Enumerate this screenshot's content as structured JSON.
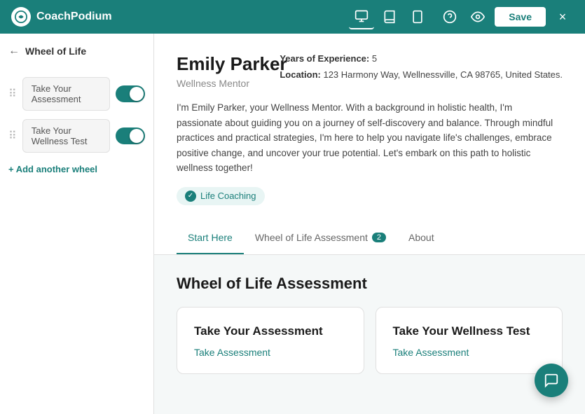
{
  "logo": {
    "name": "CoachPodium",
    "icon": "C"
  },
  "nav": {
    "icons": [
      {
        "id": "desktop",
        "label": "Desktop view",
        "unicode": "🖥",
        "active": true
      },
      {
        "id": "book",
        "label": "Book view",
        "unicode": "📖",
        "active": false
      },
      {
        "id": "mobile",
        "label": "Mobile view",
        "unicode": "📱",
        "active": false
      }
    ],
    "help_icon": "?",
    "eye_icon": "👁",
    "save_label": "Save",
    "close_label": "×"
  },
  "sidebar": {
    "title": "Wheel of Life",
    "back_label": "←",
    "items": [
      {
        "id": "item1",
        "label": "Take Your Assessment",
        "toggle_on": true
      },
      {
        "id": "item2",
        "label": "Take Your Wellness Test",
        "toggle_on": true
      }
    ],
    "add_wheel_label": "+ Add another wheel"
  },
  "profile": {
    "name": "Emily Parker",
    "role": "Wellness Mentor",
    "bio": "I'm Emily Parker, your Wellness Mentor. With a background in holistic health, I'm passionate about guiding you on a journey of self-discovery and balance. Through mindful practices and practical strategies, I'm here to help you navigate life's challenges, embrace positive change, and uncover your true potential. Let's embark on this path to holistic wellness together!",
    "tag": "Life Coaching",
    "meta": {
      "years_label": "Years of Experience:",
      "years_value": "5",
      "location_label": "Location:",
      "location_value": "123 Harmony Way, Wellnessville, CA 98765, United States."
    }
  },
  "tabs": [
    {
      "id": "start-here",
      "label": "Start Here",
      "active": true,
      "badge": null
    },
    {
      "id": "wheel-assessment",
      "label": "Wheel of Life Assessment",
      "active": false,
      "badge": "2"
    },
    {
      "id": "about",
      "label": "About",
      "active": false,
      "badge": null
    }
  ],
  "section": {
    "title": "Wheel of Life Assessment",
    "cards": [
      {
        "id": "card1",
        "title": "Take Your Assessment",
        "link_label": "Take Assessment"
      },
      {
        "id": "card2",
        "title": "Take Your Wellness Test",
        "link_label": "Take Assessment"
      }
    ]
  },
  "chat_fab": "💬"
}
